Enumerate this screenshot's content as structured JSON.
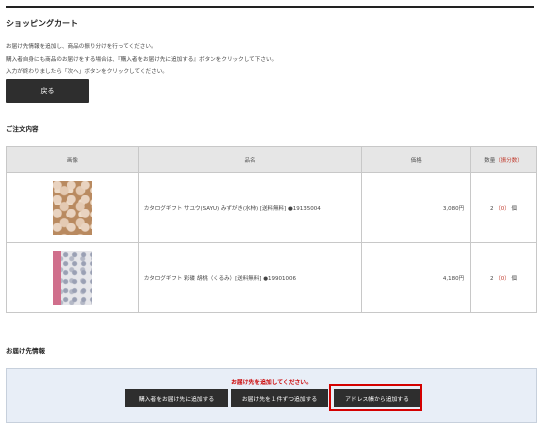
{
  "header": {
    "title": "ショッピングカート"
  },
  "instructions": [
    "お届け先情報を追加し、商品の振り分けを行ってください。",
    "購入者自身にも商品のお届けをする場合は、『購入者をお届け先に追加する』ボタンをクリックして下さい。",
    "入力が終わりましたら「次へ」ボタンをクリックしてください。"
  ],
  "back_button": "戻る",
  "order": {
    "title": "ご注文内容",
    "headers": {
      "image": "画像",
      "name": "品名",
      "price": "価格",
      "qty": "数量",
      "qty_note": "（振分数）"
    },
    "items": [
      {
        "name": "カタログギフト サユウ(SAYU) みずがき(水柿) [送料無料] ●19135004",
        "price": "3,080円",
        "qty": "2",
        "alloc": "（0）",
        "unit": "個"
      },
      {
        "name": "カタログギフト 彩碟 胡桃（くるみ）[送料無料] ●19901006",
        "price": "4,180円",
        "qty": "2",
        "alloc": "（0）",
        "unit": "個"
      }
    ]
  },
  "shipping": {
    "title": "お届け先情報",
    "message": "お届け先を追加してください。",
    "buttons": {
      "add_buyer": "購入者をお届け先に追加する",
      "add_one": "お届け先を１件ずつ追加する",
      "add_address_book": "アドレス帳から追加する"
    }
  },
  "colors": {
    "dark_button": "#2e2e2e",
    "alert": "#c00000",
    "highlight": "#d40000",
    "panel": "#e8eef7"
  }
}
